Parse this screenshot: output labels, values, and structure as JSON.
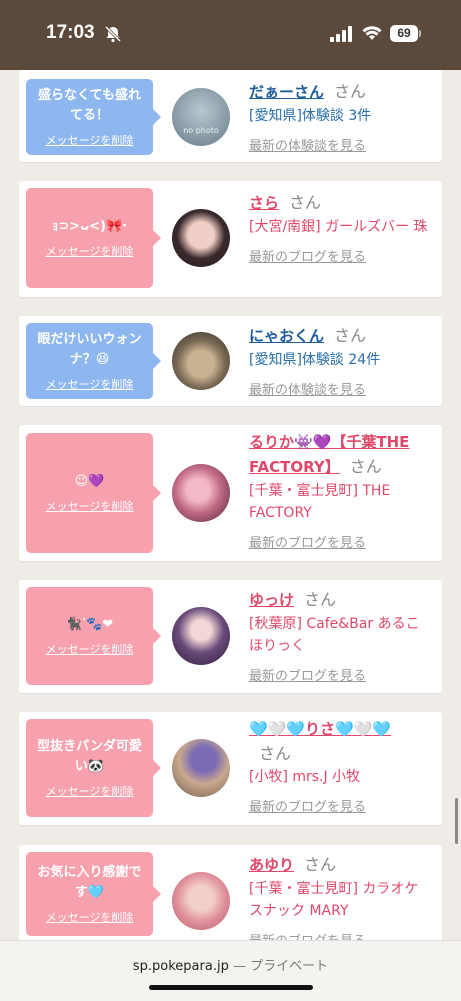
{
  "status_bar": {
    "time": "17:03",
    "battery": "69"
  },
  "bubble_delete_label": "メッセージを削除",
  "san_label": "さん",
  "cards": [
    {
      "message": "盛らなくても盛れてる！",
      "name": "だぁーさん",
      "shop": "[愛知県]体験談 3件",
      "more": "最新の体験談を見る",
      "theme": "blue",
      "avatar_text": "no photo"
    },
    {
      "message": "ｮ⊃>ᴗ<)🎀·",
      "name": "さら",
      "shop": "[大宮/南銀] ガールズバー 珠",
      "more": "最新のブログを見る",
      "theme": "pink"
    },
    {
      "message": "眼だけいいウォンナ？😆",
      "name": "にゃおくん",
      "shop": "[愛知県]体験談 24件",
      "more": "最新の体験談を見る",
      "theme": "blue"
    },
    {
      "message": "😉💜",
      "name": "るりか👾💜【千葉THE FACTORY】",
      "shop": "[千葉・富士見町] THE FACTORY",
      "more": "最新のブログを見る",
      "theme": "pink"
    },
    {
      "message": "🐈‍⬛ᐝ🐾❤",
      "name": "ゆっけ",
      "shop": "[秋葉原] Cafe&Bar あるこほりっく",
      "more": "最新のブログを見る",
      "theme": "pink"
    },
    {
      "message": "型抜きパンダ可愛い🐼",
      "name": "🩵🤍🩵りさ🩵🤍🩵",
      "shop": "[小牧] mrs.J 小牧",
      "more": "最新のブログを見る",
      "theme": "pink"
    },
    {
      "message": "お気に入り感謝です🩵",
      "name": "あゆり",
      "shop": "[千葉・富士見町] カラオケスナック MARY",
      "more": "最新のブログを見る",
      "theme": "pink"
    }
  ],
  "url_bar": {
    "domain": "sp.pokepara.jp",
    "privacy": "— プライベート"
  }
}
